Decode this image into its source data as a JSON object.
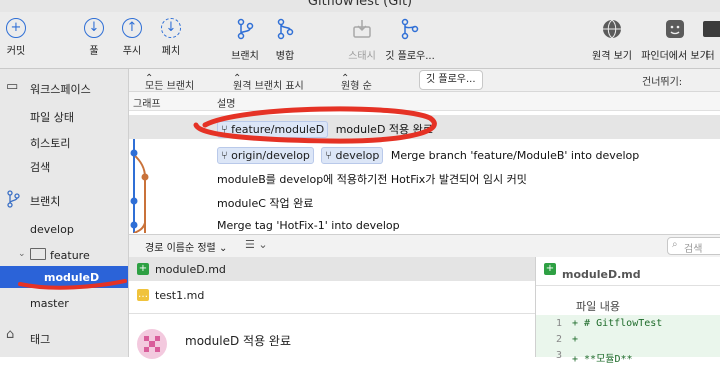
{
  "window": {
    "title": "GitflowTest (Git)"
  },
  "toolbar": {
    "commit": "커밋",
    "pull": "풀",
    "push": "푸시",
    "fetch": "페치",
    "branch": "브랜치",
    "merge": "병합",
    "stash": "스태시",
    "gitflow": "깃 플로우...",
    "remote_view": "원격 보기",
    "show_in_finder": "파인더에서 보기",
    "terminal": "터"
  },
  "sidebar": {
    "workspace": "워크스페이스",
    "file_status": "파일 상태",
    "history": "히스토리",
    "search": "검색",
    "branches": "브랜치",
    "branch_develop": "develop",
    "folder_feature": "feature",
    "branch_moduleD": "moduleD",
    "branch_master": "master",
    "tags": "태그"
  },
  "filter_bar": {
    "all_branches": "모든 브랜치",
    "show_remote": "원격 브랜치 표시",
    "sort_order": "원형 순",
    "gitflow_button": "깃 플로우...",
    "skip_to": "건너뛰기:"
  },
  "columns": {
    "graph": "그래프",
    "description": "설명"
  },
  "commits": [
    {
      "tags": [
        "feature/moduleD"
      ],
      "message": "moduleD 적용 완료"
    },
    {
      "tags": [
        "origin/develop",
        "develop"
      ],
      "message": "Merge branch 'feature/ModuleB' into develop"
    },
    {
      "tags": [],
      "message": "moduleB를 develop에 적용하기전 HotFix가 발견되어 임시 커밋"
    },
    {
      "tags": [],
      "message": "moduleC 작업 완료"
    },
    {
      "tags": [],
      "message": "Merge tag 'HotFix-1' into develop"
    }
  ],
  "files_bar": {
    "sort": "경로 이름순 정렬",
    "search_placeholder": "검색"
  },
  "files": [
    {
      "name": "moduleD.md",
      "status": "added"
    },
    {
      "name": "test1.md",
      "status": "modified"
    }
  ],
  "commit_detail": {
    "message": "moduleD 적용 완료"
  },
  "diff": {
    "file": "moduleD.md",
    "hunk_label": "파일 내용",
    "lines": [
      {
        "no": "1",
        "text": "+ # GitflowTest"
      },
      {
        "no": "2",
        "text": "+"
      },
      {
        "no": "3",
        "text": "+ **모듈D**"
      }
    ]
  }
}
